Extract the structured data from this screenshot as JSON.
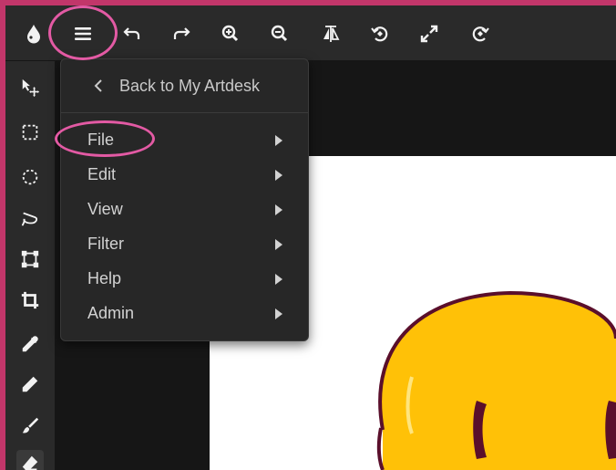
{
  "menu": {
    "back_label": "Back to My Artdesk",
    "items": [
      {
        "label": "File"
      },
      {
        "label": "Edit"
      },
      {
        "label": "View"
      },
      {
        "label": "Filter"
      },
      {
        "label": "Help"
      },
      {
        "label": "Admin"
      }
    ]
  },
  "colors": {
    "frame": "#c2366a",
    "highlight": "#e35aa4",
    "emoji_face": "#ffc107",
    "emoji_eye": "#5a0f2b"
  }
}
